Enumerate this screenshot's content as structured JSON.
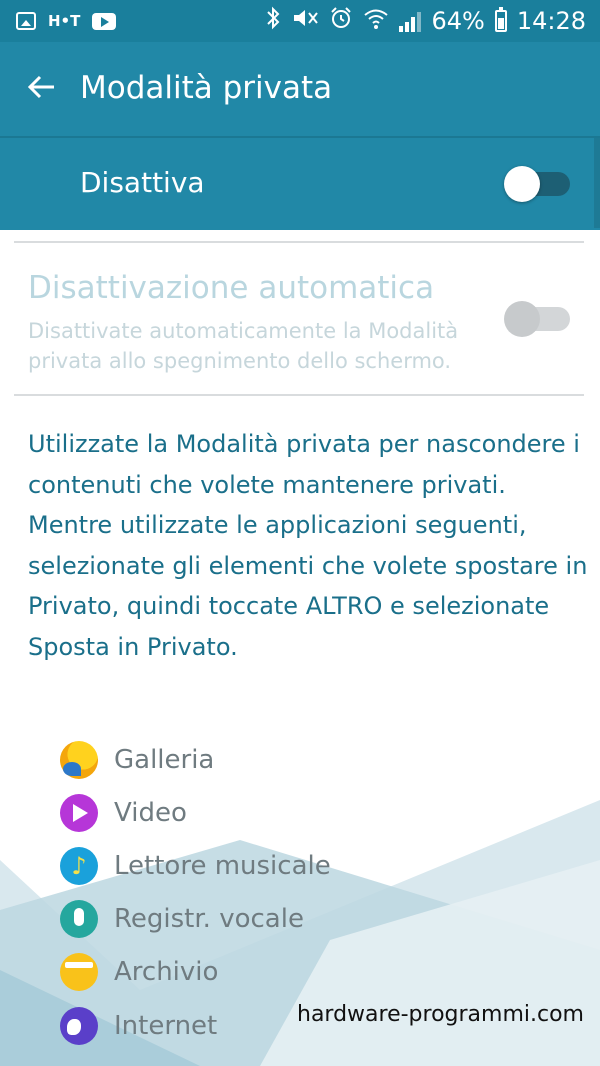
{
  "status_bar": {
    "app_icons": [
      "gallery-icon",
      "ht-icon",
      "youtube-icon"
    ],
    "ht_label": "H•T",
    "right_icons": [
      "bluetooth-icon",
      "mute-icon",
      "alarm-icon",
      "wifi-icon",
      "signal-icon"
    ],
    "battery": "64%",
    "time": "14:28"
  },
  "app_bar": {
    "title": "Modalità privata"
  },
  "master_switch": {
    "label": "Disattiva",
    "on": false
  },
  "auto_disable": {
    "title": "Disattivazione automatica",
    "subtitle": "Disattivate automaticamente la Modalità privata allo spegnimento dello schermo.",
    "on": false,
    "enabled": false
  },
  "description": "Utilizzate la Modalità privata per nascondere i contenuti che volete mantenere privati. Mentre utilizzate le applicazioni seguenti, selezionate gli elementi che volete spostare in Privato, quindi toccate ALTRO e selezionate Sposta in Privato.",
  "apps": [
    {
      "name": "Galleria",
      "icon": "gallery-icon"
    },
    {
      "name": "Video",
      "icon": "video-icon"
    },
    {
      "name": "Lettore musicale",
      "icon": "music-icon"
    },
    {
      "name": "Registr. vocale",
      "icon": "voice-recorder-icon"
    },
    {
      "name": "Archivio",
      "icon": "archive-icon"
    },
    {
      "name": "Internet",
      "icon": "internet-icon"
    }
  ],
  "watermark": "hardware-programmi.com",
  "colors": {
    "status_bar": "#1a7f9c",
    "app_bar": "#2188a7",
    "description_text": "#1a6f8a",
    "disabled_text": "#b9d6df"
  }
}
